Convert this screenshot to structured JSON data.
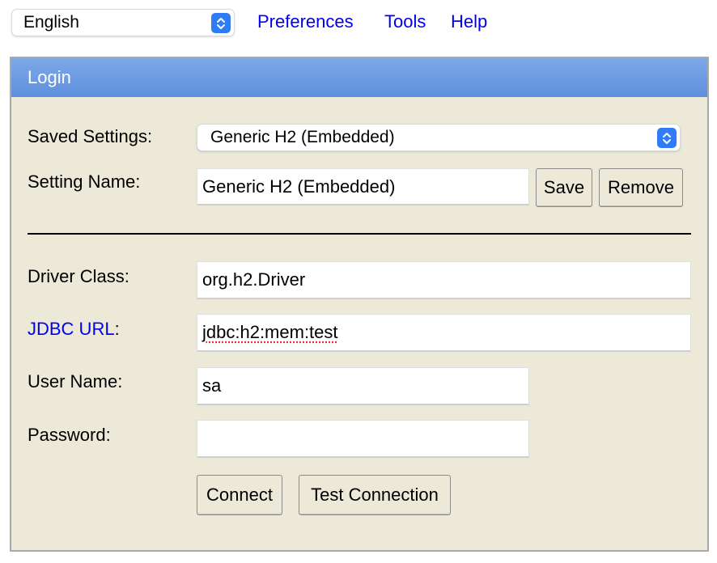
{
  "topbar": {
    "language_selected": "English",
    "links": {
      "preferences": "Preferences",
      "tools": "Tools",
      "help": "Help"
    }
  },
  "panel": {
    "title": "Login",
    "saved_settings": {
      "label": "Saved Settings:",
      "selected": "Generic H2 (Embedded)"
    },
    "setting_name": {
      "label": "Setting Name:",
      "value": "Generic H2 (Embedded)",
      "save_label": "Save",
      "remove_label": "Remove"
    },
    "driver_class": {
      "label": "Driver Class:",
      "value": "org.h2.Driver"
    },
    "jdbc_url": {
      "label_link": "JDBC URL",
      "label_suffix": ":",
      "value": "jdbc:h2:mem:test"
    },
    "user_name": {
      "label": "User Name:",
      "value": "sa"
    },
    "password": {
      "label": "Password:",
      "value": ""
    },
    "buttons": {
      "connect": "Connect",
      "test_connection": "Test Connection"
    }
  },
  "colors": {
    "panel_bg": "#ece9d8",
    "header_blue": "#6b99e2",
    "link_blue": "#0000ee",
    "stepper_blue": "#2f7cf6"
  }
}
